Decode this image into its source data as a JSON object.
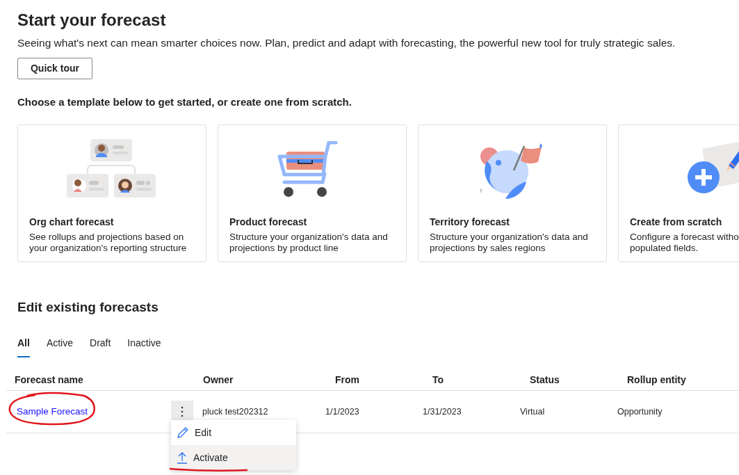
{
  "header": {
    "title": "Start your forecast",
    "subtitle": "Seeing what's next can mean smarter choices now. Plan, predict and adapt with forecasting, the powerful new tool for truly strategic sales.",
    "button": "Quick tour"
  },
  "templates": {
    "heading": "Choose a template below to get started, or create one from scratch.",
    "cards": [
      {
        "kind": "org",
        "title": "Org chart forecast",
        "description": "See rollups and projections based on your organization's reporting structure"
      },
      {
        "kind": "product",
        "title": "Product forecast",
        "description": "Structure your organization's data and projections by product line"
      },
      {
        "kind": "territory",
        "title": "Territory forecast",
        "description": "Structure your organization's data and projections by sales regions"
      },
      {
        "kind": "scratch",
        "title": "Create from scratch",
        "description": "Configure a forecast witho\npopulated fields."
      }
    ]
  },
  "existing": {
    "heading": "Edit existing forecasts",
    "tabs": [
      {
        "label": "All",
        "selected": true
      },
      {
        "label": "Active",
        "selected": false
      },
      {
        "label": "Draft",
        "selected": false
      },
      {
        "label": "Inactive",
        "selected": false
      }
    ],
    "table": {
      "columns": [
        "Forecast name",
        "Owner",
        "From",
        "To",
        "Status",
        "Rollup entity"
      ],
      "rows": [
        {
          "name": "Sample Forecast",
          "owner": "pluck test202312",
          "from": "1/1/2023",
          "to": "1/31/2023",
          "status": "Virtual",
          "rollup": "Opportunity",
          "menu_open": true
        }
      ]
    },
    "menu": [
      {
        "kind": "edit",
        "label": "Edit",
        "selected": false
      },
      {
        "kind": "activate",
        "label": "Activate",
        "selected": true
      }
    ]
  }
}
